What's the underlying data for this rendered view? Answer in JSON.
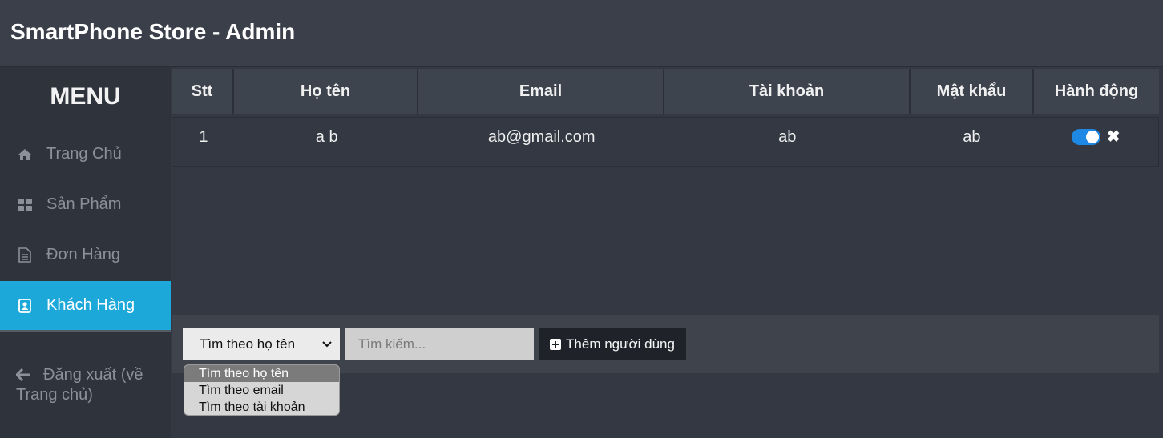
{
  "header": {
    "title": "SmartPhone Store - Admin"
  },
  "sidebar": {
    "menu_title": "MENU",
    "items": [
      {
        "label": "Trang Chủ",
        "icon": "home-icon"
      },
      {
        "label": "Sản Phẩm",
        "icon": "grid-icon"
      },
      {
        "label": "Đơn Hàng",
        "icon": "document-icon"
      },
      {
        "label": "Khách Hàng",
        "icon": "contact-icon",
        "active": true
      }
    ],
    "logout": {
      "label": "Đăng xuất (về Trang chủ)",
      "icon": "arrow-left-icon"
    }
  },
  "table": {
    "columns": [
      "Stt",
      "Họ tên",
      "Email",
      "Tài khoản",
      "Mật khẩu",
      "Hành động"
    ],
    "rows": [
      {
        "stt": "1",
        "name": "a b",
        "email": "ab@gmail.com",
        "account": "ab",
        "password": "ab"
      }
    ]
  },
  "bottom": {
    "select_value": "Tìm theo họ tên",
    "search_placeholder": "Tìm kiếm...",
    "add_button": "Thêm người dùng"
  },
  "dropdown": {
    "options": [
      "Tìm theo họ tên",
      "Tìm theo email",
      "Tìm theo tài khoản"
    ]
  },
  "colors": {
    "accent": "#1da8da",
    "toggle": "#1e88e5",
    "background": "#333842"
  }
}
